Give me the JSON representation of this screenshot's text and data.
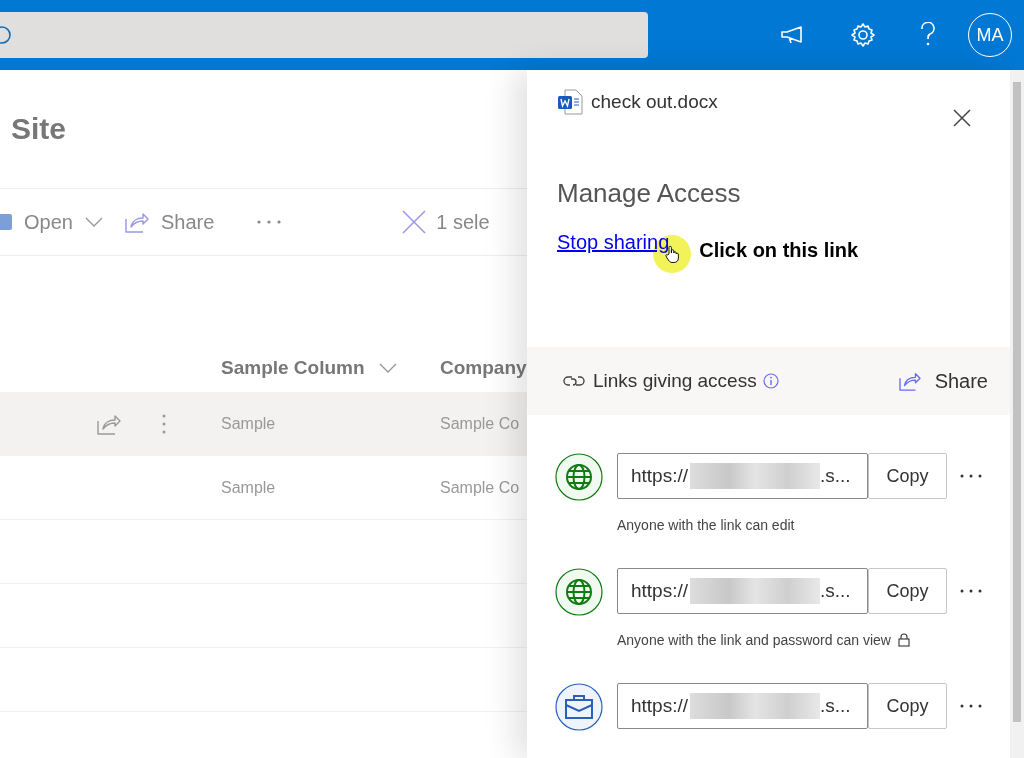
{
  "top_bar": {
    "avatar_initials": "MA"
  },
  "site": {
    "title": "Site",
    "toolbar": [
      {
        "kind": "open",
        "label": "Open"
      },
      {
        "kind": "share",
        "label": "Share"
      },
      {
        "kind": "more"
      }
    ],
    "selection": "1 sele",
    "columns": [
      {
        "label": "Sample Column"
      },
      {
        "label": "Company"
      }
    ],
    "rows": [
      {
        "selected": true,
        "cells": [
          "Sample",
          "Sample Co"
        ]
      },
      {
        "selected": false,
        "cells": [
          "Sample",
          "Sample Co"
        ]
      }
    ]
  },
  "panel": {
    "file_name": "check out.docx",
    "title": "Manage Access",
    "stop_sharing": "Stop sharing",
    "annotation": "Click on this link",
    "links_header": {
      "label": "Links giving access",
      "share": "Share"
    },
    "links": [
      {
        "kind": "anyone",
        "url_start": "https://",
        "url_end": ".s...",
        "copy": "Copy",
        "description": "Anyone with the link can edit",
        "locked": false
      },
      {
        "kind": "anyone",
        "url_start": "https://",
        "url_end": ".s...",
        "copy": "Copy",
        "description": "Anyone with the link and password can view",
        "locked": true
      },
      {
        "kind": "organization",
        "url_start": "https://",
        "url_end": ".s...",
        "copy": "Copy"
      }
    ]
  }
}
